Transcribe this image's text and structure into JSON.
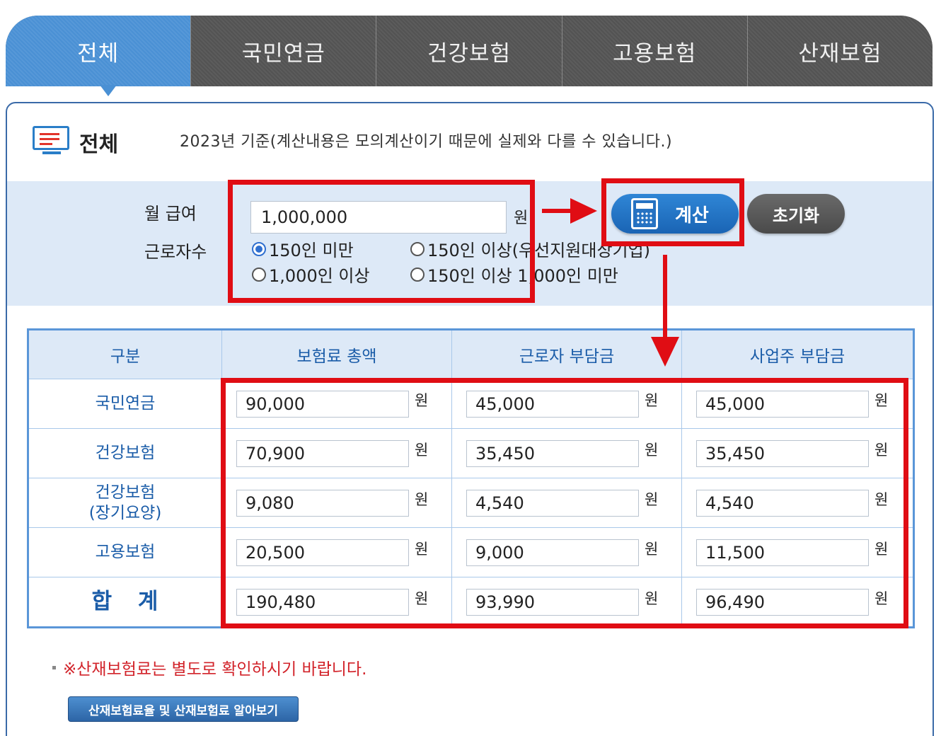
{
  "tabs": [
    {
      "label": "전체",
      "active": true
    },
    {
      "label": "국민연금",
      "active": false
    },
    {
      "label": "건강보험",
      "active": false
    },
    {
      "label": "고용보험",
      "active": false
    },
    {
      "label": "산재보험",
      "active": false
    }
  ],
  "panel": {
    "title": "전체",
    "note": "2023년 기준(계산내용은 모의계산이기 때문에 실제와 다를 수 있습니다.)"
  },
  "form": {
    "salary_label": "월 급여",
    "salary_value": "1,000,000",
    "salary_unit": "원",
    "workers_label": "근로자수",
    "options": [
      {
        "label": "150인 미만",
        "checked": true
      },
      {
        "label": "150인 이상(우선지원대상기업)",
        "checked": false
      },
      {
        "label": "1,000인 이상",
        "checked": false
      },
      {
        "label": "150인 이상 1,000인 미만",
        "checked": false
      }
    ],
    "calc_button": "계산",
    "reset_button": "초기화"
  },
  "table": {
    "headers": [
      "구분",
      "보험료 총액",
      "근로자 부담금",
      "사업주 부담금"
    ],
    "unit": "원",
    "rows": [
      {
        "label": "국민연금",
        "label2": "",
        "total": "90,000",
        "employee": "45,000",
        "employer": "45,000"
      },
      {
        "label": "건강보험",
        "label2": "",
        "total": "70,900",
        "employee": "35,450",
        "employer": "35,450"
      },
      {
        "label": "건강보험",
        "label2": "(장기요양)",
        "total": "9,080",
        "employee": "4,540",
        "employer": "4,540"
      },
      {
        "label": "고용보험",
        "label2": "",
        "total": "20,500",
        "employee": "9,000",
        "employer": "11,500"
      },
      {
        "label": "합 계",
        "label2": "",
        "total": "190,480",
        "employee": "93,990",
        "employer": "96,490"
      }
    ]
  },
  "footer": {
    "note": "※산재보험료는 별도로 확인하시기 바랍니다.",
    "link_button": "산재보험료율 및 산재보험료 알아보기"
  },
  "colors": {
    "active_tab": "#4a90d4",
    "inactive_tab": "#5a5a5a",
    "annotation_red": "#e00d14",
    "label_blue": "#1a5ca8",
    "note_red": "#d2232a"
  }
}
